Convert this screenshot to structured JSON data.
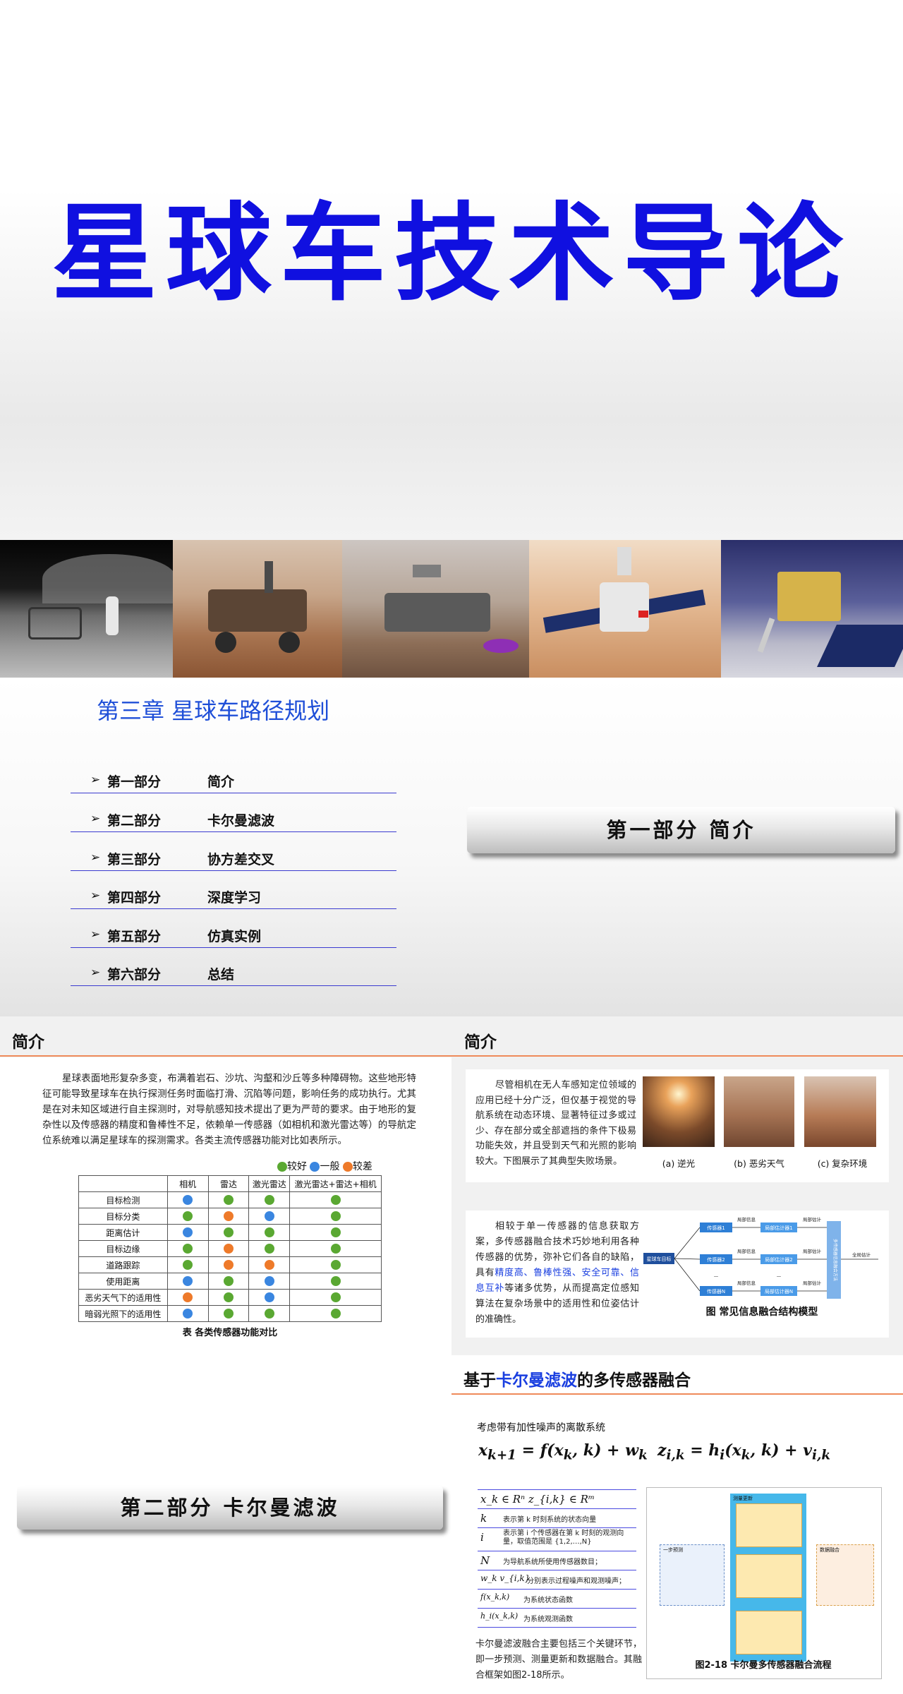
{
  "slide1": {
    "title": "星球车技术导论",
    "banner_photos": [
      "lunar-rover-astronaut",
      "mars-rover-curiosity",
      "mars-rover-perseverance",
      "zhurong-rover",
      "lunar-lander"
    ]
  },
  "slide2": {
    "chapter": "第三章 星球车路径规划",
    "toc": [
      {
        "part": "第一部分",
        "name": "简介"
      },
      {
        "part": "第二部分",
        "name": "卡尔曼滤波"
      },
      {
        "part": "第三部分",
        "name": "协方差交叉"
      },
      {
        "part": "第四部分",
        "name": "深度学习"
      },
      {
        "part": "第五部分",
        "name": "仿真实例"
      },
      {
        "part": "第六部分",
        "name": "总结"
      }
    ],
    "section_button": "第一部分 简介"
  },
  "slide3": {
    "left_title": "简介",
    "left_para": "星球表面地形复杂多变，布满着岩石、沙坑、沟壑和沙丘等多种障碍物。这些地形特征可能导致星球车在执行探测任务时面临打滑、沉陷等问题，影响任务的成功执行。尤其是在对未知区域进行自主探测时，对导航感知技术提出了更为严苛的要求。由于地形的复杂性以及传感器的精度和鲁棒性不足，依赖单一传感器（如相机和激光雷达等）的导航定位系统难以满足星球车的探测需求。各类主流传感器功能对比如表所示。",
    "legend": [
      "较好",
      "一般",
      "较差"
    ],
    "table_headers": [
      "",
      "相机",
      "雷达",
      "激光雷达",
      "激光雷达+雷达+相机"
    ],
    "table_rows": [
      {
        "label": "目标检测",
        "vals": [
          "b",
          "g",
          "g",
          "g"
        ]
      },
      {
        "label": "目标分类",
        "vals": [
          "g",
          "o",
          "b",
          "g"
        ]
      },
      {
        "label": "距离估计",
        "vals": [
          "b",
          "g",
          "g",
          "g"
        ]
      },
      {
        "label": "目标边缘",
        "vals": [
          "g",
          "o",
          "g",
          "g"
        ]
      },
      {
        "label": "道路跟踪",
        "vals": [
          "g",
          "o",
          "o",
          "g"
        ]
      },
      {
        "label": "使用距离",
        "vals": [
          "b",
          "g",
          "b",
          "g"
        ]
      },
      {
        "label": "恶劣天气下的适用性",
        "vals": [
          "o",
          "g",
          "b",
          "g"
        ]
      },
      {
        "label": "暗弱光照下的适用性",
        "vals": [
          "b",
          "g",
          "g",
          "g"
        ]
      }
    ],
    "table_caption": "表  各类传感器功能对比",
    "right_title": "简介",
    "right_para1": "尽管相机在无人车感知定位领域的应用已经十分广泛，但仅基于视觉的导航系统在动态环境、显著特征过多或过少、存在部分或全部遮挡的条件下极易功能失效，并且受到天气和光照的影响较大。下图展示了其典型失败场景。",
    "captions": [
      "(a) 逆光",
      "(b) 恶劣天气",
      "(c) 复杂环境"
    ],
    "right_para2_a": "相较于单一传感器的信息获取方案，多传感器融合技术巧妙地利用各种传感器的优势，弥补它们各自的缺陷，具有",
    "right_para2_hl": "精度高、鲁棒性强、安全可靠、信息互补",
    "right_para2_b": "等诸多优势，从而提高定位感知算法在复杂场景中的适用性和位姿估计的准确性。",
    "diagram": {
      "input": "星球车目标",
      "sensors": [
        "传感器1",
        "传感器2",
        "传感器N"
      ],
      "edge_label": "局部信息",
      "estimators": [
        "局部估计器1",
        "局部估计器2",
        "局部估计器N"
      ],
      "edge_label2": "局部估计",
      "fusion": "多传感器信息融合方法",
      "output": "全局估计"
    },
    "diagram_caption": "图  常见信息融合结构模型"
  },
  "slide4": {
    "left_button": "第二部分 卡尔曼滤波",
    "title_pre": "基于",
    "title_hl": "卡尔曼滤波",
    "title_post": "的多传感器融合",
    "intro": "考虑带有加性噪声的离散系统",
    "eq1": "x_{k+1} = f(x_k, k) + w_k",
    "eq2": "z_{i,k} = h_i(x_k, k) + v_{i,k}",
    "defs": [
      {
        "sym": "x_k ∈ Rⁿ   z_{i,k} ∈ Rᵐ",
        "desc": ""
      },
      {
        "sym": "k",
        "desc": "表示第 k 时刻系统的状态向量"
      },
      {
        "sym": "i",
        "desc": "表示第 i 个传感器在第 k 时刻的观测向量，取值范围是 {1,2,…,N}"
      },
      {
        "sym": "N",
        "desc": "为导航系统所使用传感器数目；"
      },
      {
        "sym": "w_k  v_{i,k}",
        "desc": "分别表示过程噪声和观测噪声；"
      },
      {
        "sym": "f(x_k,k)",
        "desc": "为系统状态函数"
      },
      {
        "sym": "h_i(x_k,k)",
        "desc": "为系统观测函数"
      }
    ],
    "bottom_para": "卡尔曼滤波融合主要包括三个关键环节，即一步预测、测量更新和数据融合。其融合框架如图2-18所示。",
    "fig_caption": "图2-18  卡尔曼多传感器融合流程",
    "fig_labels": {
      "left_box": "一步预测",
      "mid_box": "测量更新",
      "right_box": "数据融合"
    }
  },
  "colors": {
    "title_blue": "#1010e0",
    "accent_blue": "#1f4fd8",
    "rule_orange": "#ef8a5a",
    "good": "#5aa832",
    "fair": "#3a86e0",
    "poor": "#ee7a2a"
  }
}
